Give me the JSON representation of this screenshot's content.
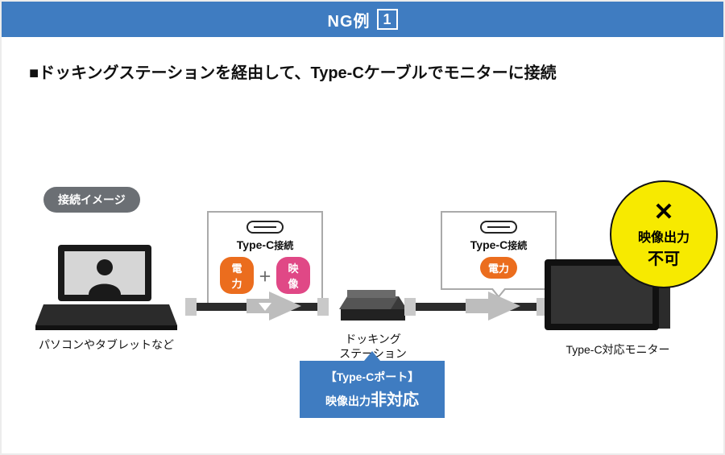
{
  "title": {
    "prefix": "NG例",
    "number": "1"
  },
  "description": "■ドッキングステーションを経由して、Type-Cケーブルでモニターに接続",
  "badge": "接続イメージ",
  "devices": {
    "laptop": "パソコンやタブレットなど",
    "dock_line1": "ドッキング",
    "dock_line2": "ステーション",
    "monitor": "Type-C対応モニター"
  },
  "balloon1": {
    "type_bold": "Type-C",
    "type_small": "接続",
    "pill1": "電力",
    "plus": "＋",
    "pill2": "映像"
  },
  "balloon2": {
    "type_bold": "Type-C",
    "type_small": "接続",
    "pill1": "電力"
  },
  "circle": {
    "x": "✕",
    "line1": "映像出力",
    "line2": "不可"
  },
  "note": {
    "line1": "【Type-Cポート】",
    "line2_small": "映像出力",
    "line2_big": "非対応"
  }
}
